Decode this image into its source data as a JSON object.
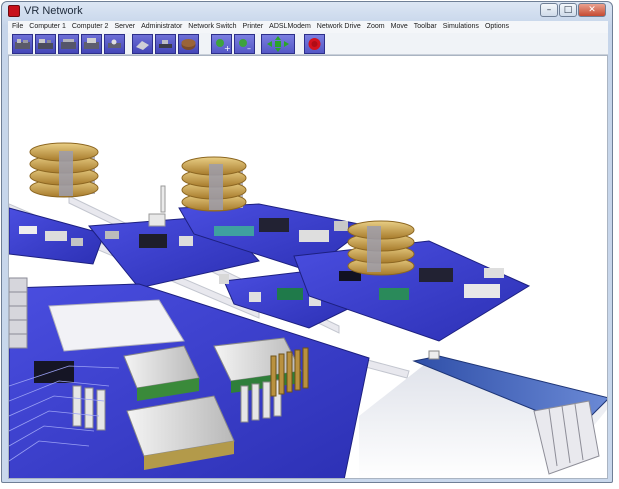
{
  "window": {
    "title": "VR Network"
  },
  "menu": [
    "File",
    "Computer 1",
    "Computer 2",
    "Server",
    "Administrator",
    "Network Switch",
    "Printer",
    "ADSLModem",
    "Network Drive",
    "Zoom",
    "Move",
    "Toolbar",
    "Simulations",
    "Options"
  ],
  "toolbar": {
    "buttons": [
      {
        "name": "add-computer1-button",
        "icon": "computer-board-icon"
      },
      {
        "name": "add-computer2-button",
        "icon": "computer-board-icon"
      },
      {
        "name": "add-server-button",
        "icon": "server-board-icon"
      },
      {
        "name": "add-administrator-button",
        "icon": "admin-board-icon"
      },
      {
        "name": "add-switch-button",
        "icon": "switch-icon"
      },
      {
        "name": "add-printer-button",
        "icon": "printer-icon"
      },
      {
        "name": "add-modem-button",
        "icon": "modem-icon"
      },
      {
        "name": "add-drive-button",
        "icon": "drive-icon"
      },
      {
        "name": "zoom-in-button",
        "icon": "zoom-in-icon"
      },
      {
        "name": "zoom-out-button",
        "icon": "zoom-out-icon"
      },
      {
        "name": "move-button",
        "icon": "move-arrows-icon"
      },
      {
        "name": "stop-simulation-button",
        "icon": "stop-icon"
      }
    ]
  },
  "colors": {
    "board": "#3b3fd4",
    "board_dark": "#2a2ea8",
    "heatsink": "#d8d8d8",
    "fan": "#c9a24a",
    "stop": "#d4121e",
    "accent": "#2b9a2b"
  }
}
